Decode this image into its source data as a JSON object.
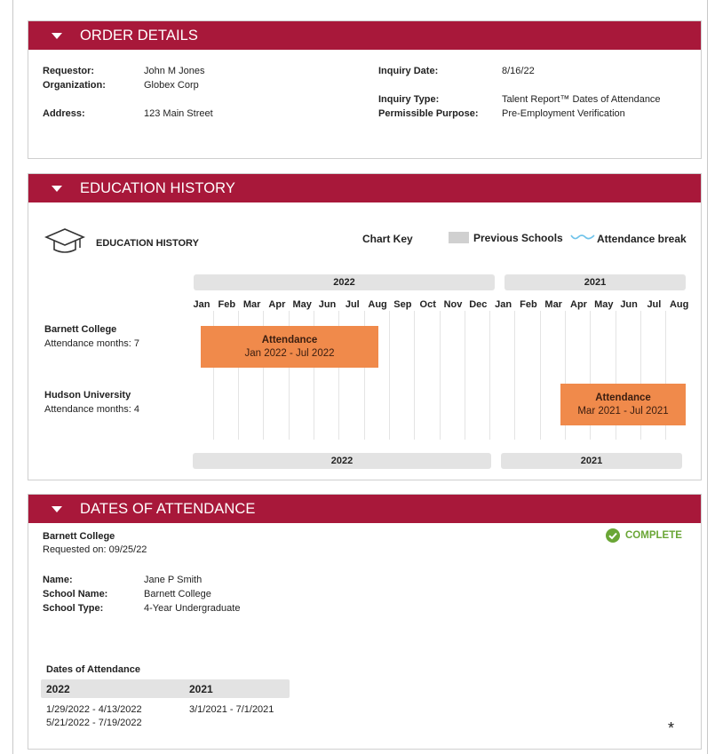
{
  "order": {
    "header": "ORDER DETAILS",
    "requestor_label": "Requestor:",
    "requestor": "John M Jones",
    "organization_label": "Organization:",
    "organization": "Globex Corp",
    "address_label": "Address:",
    "address": "123 Main Street",
    "inquiry_date_label": "Inquiry Date:",
    "inquiry_date": "8/16/22",
    "inquiry_type_label": "Inquiry Type:",
    "inquiry_type": "Talent Report™ Dates of Attendance",
    "purpose_label": "Permissible Purpose:",
    "purpose": "Pre-Employment Verification"
  },
  "education": {
    "header": "EDUCATION HISTORY",
    "title": "EDUCATION HISTORY",
    "chart_key_label": "Chart Key",
    "key_previous": "Previous Schools",
    "key_break": "Attendance break",
    "year_left": "2022",
    "year_right": "2021",
    "months_2022": [
      "Jan",
      "Feb",
      "Mar",
      "Apr",
      "May",
      "Jun",
      "Jul",
      "Aug",
      "Sep",
      "Oct",
      "Nov",
      "Dec"
    ],
    "months_2021": [
      "Jan",
      "Feb",
      "Mar",
      "Apr",
      "May",
      "Jun",
      "Jul",
      "Aug"
    ],
    "schools": [
      {
        "name": "Barnett College",
        "months": "Attendance months: 7",
        "bar_title": "Attendance",
        "bar_range": "Jan 2022 - Jul 2022"
      },
      {
        "name": "Hudson University",
        "months": "Attendance months: 4",
        "bar_title": "Attendance",
        "bar_range": "Mar 2021 - Jul 2021"
      }
    ]
  },
  "attendance": {
    "header": "DATES OF ATTENDANCE",
    "school": "Barnett College",
    "requested": "Requested on: 09/25/22",
    "status": "COMPLETE",
    "status_color": "#6aa636",
    "name_label": "Name:",
    "name": "Jane P Smith",
    "school_name_label": "School Name:",
    "school_name": "Barnett College",
    "school_type_label": "School Type:",
    "school_type": "4-Year Undergraduate",
    "dates_title": "Dates of Attendance",
    "col_2022": "2022",
    "col_2021": "2021",
    "dates_2022": [
      "1/29/2022 - 4/13/2022",
      "5/21/2022 - 7/19/2022"
    ],
    "dates_2021": [
      "3/1/2021 - 7/1/2021"
    ],
    "footnote": "*"
  },
  "colors": {
    "brand": "#a8183a",
    "bar": "#f08a4b",
    "break_line": "#6fc3ea"
  }
}
